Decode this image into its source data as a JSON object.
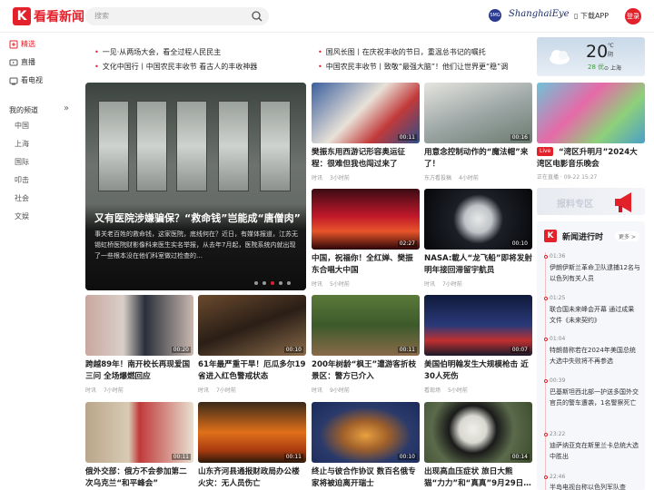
{
  "header": {
    "logo_mark": "K",
    "logo_text": "看看新闻",
    "search_placeholder": "搜索",
    "partner": "ShanghaiEye",
    "partner_badge": "SMG",
    "download": "下载APP",
    "login": "登录"
  },
  "sidebar": {
    "items": [
      {
        "label": "精选",
        "icon": "star-icon"
      },
      {
        "label": "直播",
        "icon": "live-icon"
      },
      {
        "label": "看电视",
        "icon": "tv-icon"
      }
    ],
    "channels_title": "我的频道",
    "channels": [
      "中国",
      "上海",
      "国际",
      "叩击",
      "社会",
      "文娱"
    ]
  },
  "tickers": [
    "一见·从两场大会，看全过程人民民主",
    "国风长图丨在庆祝丰收的节日，重温总书记的嘱托",
    "文化中国行丨中国农民丰收节 看古人的丰收神器",
    "中国农民丰收节丨致敬“最强大脑”！他们让世界更“稳”调"
  ],
  "hero": {
    "title": "又有医院涉嫌骗保？“救命钱”岂能成“唐僧肉”",
    "desc": "事关老百姓的救命钱，这家医院，底线何在？近日，有媒体报道，江苏无锡虹桥医院财影像科来医生实名举报，从去年7月起，医院系统内就出现了一些根本没在他们科室做过检查的…",
    "slides": 5,
    "active": 2
  },
  "cards": [
    {
      "title": "樊振东用西游记形容奥运征程：很难但我也闯过来了",
      "source": "时讯",
      "time": "3小时前",
      "dur": "00:11"
    },
    {
      "title": "用意念控制动作的“魔法帽”来了！",
      "source": "东方看投稿",
      "time": "4小时前",
      "dur": "00:16"
    },
    {
      "title": "中国，祝福你！全红婵、樊振东合唱大中国",
      "source": "时讯",
      "time": "5小时前",
      "dur": "02:27"
    },
    {
      "title": "NASA:載人“龙飞船”即将发射 明年接回滞留宇航员",
      "source": "时讯",
      "time": "7小时前",
      "dur": "00:10"
    },
    {
      "title": "跨越89年！南开校长再现爱国三问 全场爆燃回应",
      "source": "时讯",
      "time": "7小时前",
      "dur": "00:20"
    },
    {
      "title": "61年最严重干旱！厄瓜多尔19省进入红色警戒状态",
      "source": "时讯",
      "time": "7小时前",
      "dur": "00:10"
    },
    {
      "title": "200年树龄“枫王”遭游客折枝 景区：警方已介入",
      "source": "时讯",
      "time": "9小时前",
      "dur": "00:11"
    },
    {
      "title": "美国伯明翰发生大规模枪击 近30人死伤",
      "source": "看现场",
      "time": "5小时前",
      "dur": "00:07"
    },
    {
      "title": "俄外交部：俄方不会参加第二次乌克兰“和平峰会”",
      "source": "",
      "time": "",
      "dur": "00:11"
    },
    {
      "title": "山东齐河县通报财政局办公楼火灾：无人员伤亡",
      "source": "",
      "time": "",
      "dur": "00:11"
    },
    {
      "title": "终止与彼合作协议 数百名俄专家将被迫离开瑞士",
      "source": "",
      "time": "",
      "dur": "00:10"
    },
    {
      "title": "出现高血压症状 旅日大熊猫“力力”和“真真”9月29日…",
      "source": "",
      "time": "",
      "dur": "00:14"
    }
  ],
  "weather": {
    "temp": "20",
    "unit": "℃",
    "cond": "阴",
    "aqi": "28",
    "aqi_label": "优",
    "city": "上海"
  },
  "promo": {
    "badge": "Live",
    "title": "“湾区升明月”2024大湾区电影音乐晚会",
    "meta": "正在直播 · 09-22 15:27"
  },
  "report": {
    "label": "报料专区"
  },
  "news": {
    "title": "新闻进行时",
    "more": "更多 >",
    "items": [
      {
        "time": "01:36",
        "text": "伊朗伊斯兰革命卫队逮捕12名与以色列有关人员"
      },
      {
        "time": "01:25",
        "text": "联合国未来峰会开幕 通过成果文件《未来契约》"
      },
      {
        "time": "01:04",
        "text": "特朗普称若在2024年美国总统大选中失败将不再参选"
      },
      {
        "time": "00:39",
        "text": "巴基斯坦西北部一护送多国外交官员的警车遭袭，1名警察死亡"
      },
      {
        "time": "23:22",
        "text": "迪萨纳亚克在斯里兰卡总统大选中胜出"
      },
      {
        "time": "22:46",
        "text": "半岛电视台称以色列军队查"
      }
    ]
  }
}
